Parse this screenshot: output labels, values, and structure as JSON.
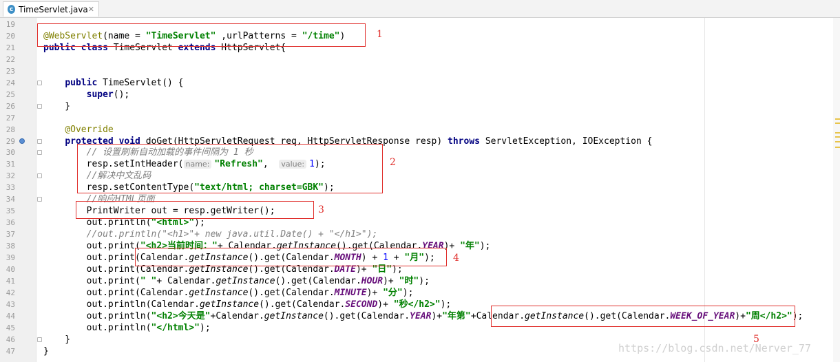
{
  "editor": {
    "tab": {
      "label": "TimeServlet.java",
      "icon_letter": "c"
    },
    "lines": [
      {
        "n": "19",
        "tokens": []
      },
      {
        "n": "20",
        "tokens": [
          {
            "c": "ann",
            "t": "@WebServlet"
          },
          {
            "c": "",
            "t": "(name = "
          },
          {
            "c": "str",
            "t": "\"TimeServlet\""
          },
          {
            "c": "",
            "t": " ,urlPatterns = "
          },
          {
            "c": "str",
            "t": "\"/time\""
          },
          {
            "c": "",
            "t": ")"
          }
        ]
      },
      {
        "n": "21",
        "tokens": [
          {
            "c": "kw",
            "t": "public class "
          },
          {
            "c": "",
            "t": "TimeServlet "
          },
          {
            "c": "kw",
            "t": "extends "
          },
          {
            "c": "",
            "t": "HttpServlet{"
          }
        ]
      },
      {
        "n": "22",
        "tokens": []
      },
      {
        "n": "23",
        "tokens": []
      },
      {
        "n": "24",
        "fold": true,
        "tokens": [
          {
            "c": "",
            "t": "    "
          },
          {
            "c": "kw",
            "t": "public "
          },
          {
            "c": "",
            "t": "TimeServlet() {"
          }
        ]
      },
      {
        "n": "25",
        "tokens": [
          {
            "c": "",
            "t": "        "
          },
          {
            "c": "kw",
            "t": "super"
          },
          {
            "c": "",
            "t": "();"
          }
        ]
      },
      {
        "n": "26",
        "fold": true,
        "tokens": [
          {
            "c": "",
            "t": "    }"
          }
        ]
      },
      {
        "n": "27",
        "tokens": []
      },
      {
        "n": "28",
        "tokens": [
          {
            "c": "",
            "t": "    "
          },
          {
            "c": "ann",
            "t": "@Override"
          }
        ]
      },
      {
        "n": "29",
        "fold": true,
        "override": true,
        "tokens": [
          {
            "c": "",
            "t": "    "
          },
          {
            "c": "kw",
            "t": "protected void "
          },
          {
            "c": "",
            "t": "doGet(HttpServletRequest req, HttpServletResponse resp) "
          },
          {
            "c": "kw",
            "t": "throws "
          },
          {
            "c": "",
            "t": "ServletException, IOException {"
          }
        ]
      },
      {
        "n": "30",
        "fold": true,
        "tokens": [
          {
            "c": "",
            "t": "        "
          },
          {
            "c": "cm",
            "t": "// 设置刷新自动加载的事件间隔为 1 秒"
          }
        ]
      },
      {
        "n": "31",
        "tokens": [
          {
            "c": "",
            "t": "        resp.setIntHeader("
          },
          {
            "c": "hint",
            "t": "name:"
          },
          {
            "c": "str",
            "t": "\"Refresh\""
          },
          {
            "c": "",
            "t": ",  "
          },
          {
            "c": "hint",
            "t": "value:"
          },
          {
            "c": "num",
            "t": "1"
          },
          {
            "c": "",
            "t": ");"
          }
        ]
      },
      {
        "n": "32",
        "fold": true,
        "tokens": [
          {
            "c": "",
            "t": "        "
          },
          {
            "c": "cm",
            "t": "//解决中文乱码"
          }
        ]
      },
      {
        "n": "33",
        "tokens": [
          {
            "c": "",
            "t": "        resp.setContentType("
          },
          {
            "c": "str",
            "t": "\"text/html; charset=GBK\""
          },
          {
            "c": "",
            "t": ");"
          }
        ]
      },
      {
        "n": "34",
        "fold": true,
        "tokens": [
          {
            "c": "",
            "t": "        "
          },
          {
            "c": "cm",
            "t": "//响应HTML页面"
          }
        ]
      },
      {
        "n": "35",
        "tokens": [
          {
            "c": "",
            "t": "        PrintWriter out = resp.getWriter();"
          }
        ]
      },
      {
        "n": "36",
        "tokens": [
          {
            "c": "",
            "t": "        out.println("
          },
          {
            "c": "str",
            "t": "\"<html>\""
          },
          {
            "c": "",
            "t": ");"
          }
        ]
      },
      {
        "n": "37",
        "tokens": [
          {
            "c": "",
            "t": "        "
          },
          {
            "c": "cm",
            "t": "//out.println(\"<h1>\"+ new java.util.Date() + \"</h1>\");"
          }
        ]
      },
      {
        "n": "38",
        "tokens": [
          {
            "c": "",
            "t": "        out.print("
          },
          {
            "c": "str",
            "t": "\"<h2>当前时间：\""
          },
          {
            "c": "",
            "t": "+ Calendar."
          },
          {
            "c": "st",
            "t": "getInstance"
          },
          {
            "c": "",
            "t": "().get(Calendar."
          },
          {
            "c": "fld",
            "t": "YEAR"
          },
          {
            "c": "",
            "t": ")+ "
          },
          {
            "c": "str",
            "t": "\"年\""
          },
          {
            "c": "",
            "t": ");"
          }
        ]
      },
      {
        "n": "39",
        "tokens": [
          {
            "c": "",
            "t": "        out.print(Calendar."
          },
          {
            "c": "st",
            "t": "getInstance"
          },
          {
            "c": "",
            "t": "().get(Calendar."
          },
          {
            "c": "fld",
            "t": "MONTH"
          },
          {
            "c": "",
            "t": ") + "
          },
          {
            "c": "num",
            "t": "1"
          },
          {
            "c": "",
            "t": " + "
          },
          {
            "c": "str",
            "t": "\"月\""
          },
          {
            "c": "",
            "t": ");"
          }
        ]
      },
      {
        "n": "40",
        "tokens": [
          {
            "c": "",
            "t": "        out.print(Calendar."
          },
          {
            "c": "st",
            "t": "getInstance"
          },
          {
            "c": "",
            "t": "().get(Calendar."
          },
          {
            "c": "fld",
            "t": "DATE"
          },
          {
            "c": "",
            "t": ")+ "
          },
          {
            "c": "str",
            "t": "\"日\""
          },
          {
            "c": "",
            "t": ");"
          }
        ]
      },
      {
        "n": "41",
        "tokens": [
          {
            "c": "",
            "t": "        out.print("
          },
          {
            "c": "str",
            "t": "\" \""
          },
          {
            "c": "",
            "t": "+ Calendar."
          },
          {
            "c": "st",
            "t": "getInstance"
          },
          {
            "c": "",
            "t": "().get(Calendar."
          },
          {
            "c": "fld",
            "t": "HOUR"
          },
          {
            "c": "",
            "t": ")+ "
          },
          {
            "c": "str",
            "t": "\"时\""
          },
          {
            "c": "",
            "t": ");"
          }
        ]
      },
      {
        "n": "42",
        "tokens": [
          {
            "c": "",
            "t": "        out.print(Calendar."
          },
          {
            "c": "st",
            "t": "getInstance"
          },
          {
            "c": "",
            "t": "().get(Calendar."
          },
          {
            "c": "fld",
            "t": "MINUTE"
          },
          {
            "c": "",
            "t": ")+ "
          },
          {
            "c": "str",
            "t": "\"分\""
          },
          {
            "c": "",
            "t": ");"
          }
        ]
      },
      {
        "n": "43",
        "tokens": [
          {
            "c": "",
            "t": "        out.println(Calendar."
          },
          {
            "c": "st",
            "t": "getInstance"
          },
          {
            "c": "",
            "t": "().get(Calendar."
          },
          {
            "c": "fld",
            "t": "SECOND"
          },
          {
            "c": "",
            "t": ")+ "
          },
          {
            "c": "str",
            "t": "\"秒</h2>\""
          },
          {
            "c": "",
            "t": ");"
          }
        ]
      },
      {
        "n": "44",
        "tokens": [
          {
            "c": "",
            "t": "        out.println("
          },
          {
            "c": "str",
            "t": "\"<h2>今天是\""
          },
          {
            "c": "",
            "t": "+Calendar."
          },
          {
            "c": "st",
            "t": "getInstance"
          },
          {
            "c": "",
            "t": "().get(Calendar."
          },
          {
            "c": "fld",
            "t": "YEAR"
          },
          {
            "c": "",
            "t": ")+"
          },
          {
            "c": "str",
            "t": "\"年第\""
          },
          {
            "c": "",
            "t": "+Calendar."
          },
          {
            "c": "st",
            "t": "getInstance"
          },
          {
            "c": "",
            "t": "().get(Calendar."
          },
          {
            "c": "fld",
            "t": "WEEK_OF_YEAR"
          },
          {
            "c": "",
            "t": ")+"
          },
          {
            "c": "str",
            "t": "\"周</h2>\""
          },
          {
            "c": "",
            "t": ");"
          }
        ]
      },
      {
        "n": "45",
        "tokens": [
          {
            "c": "",
            "t": "        out.println("
          },
          {
            "c": "str",
            "t": "\"</html>\""
          },
          {
            "c": "",
            "t": ");"
          }
        ]
      },
      {
        "n": "46",
        "fold": true,
        "tokens": [
          {
            "c": "",
            "t": "    }"
          }
        ]
      },
      {
        "n": "47",
        "tokens": [
          {
            "c": "",
            "t": "}"
          }
        ]
      }
    ]
  },
  "annotations": [
    "1",
    "2",
    "3",
    "4",
    "5"
  ],
  "watermark": "https://blog.csdn.net/Nerver_77",
  "colors": {
    "annotation": "#e0302d",
    "keyword": "#000080",
    "string": "#008000",
    "comment": "#808080",
    "field": "#660e7a"
  }
}
